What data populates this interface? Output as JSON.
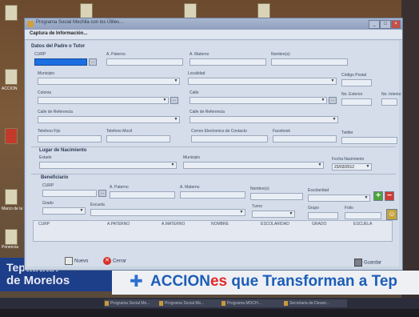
{
  "window": {
    "title": "Programa Social Mochila con los Útiles...",
    "menu": "Captura de Información..."
  },
  "padre": {
    "section": "Datos del Padre o Tutor",
    "curp_label": "CURP",
    "paterno_label": "A. Paterno",
    "materno_label": "A. Materno",
    "nombre_label": "Nombre(s)",
    "municipio_label": "Municipio",
    "localidad_label": "Localidad",
    "cp_label": "Código Postal",
    "colonia_label": "Colonia",
    "calle_label": "Calle",
    "no_ext_label": "No. Exterior",
    "no_int_label": "No. Interior",
    "calle_ref1_label": "Calle de Referencia",
    "calle_ref2_label": "Calle de Referencia",
    "tel_fijo_label": "Telefono Fijo",
    "tel_movil_label": "Telefono Movil",
    "correo_label": "Correo Electronico de Contacto",
    "facebook_label": "Facebook",
    "twitter_label": "Twitter"
  },
  "nacimiento": {
    "section": "Lugar de Nacimiento",
    "estado_label": "Estado",
    "municipio_label": "Municipio",
    "fecha_label": "Fecha Nacimiento",
    "fecha_value": "23/03/2012"
  },
  "beneficiario": {
    "section": "Beneficiario",
    "curp_label": "CURP",
    "paterno_label": "A. Paterno",
    "materno_label": "A. Materno",
    "nombre_label": "Nombre(s)",
    "escolaridad_label": "Escolaridad",
    "grado_label": "Grado",
    "escuela_label": "Escuela",
    "turno_label": "Turno",
    "grupo_label": "Grupo",
    "folio_label": "Folio"
  },
  "grid_columns": [
    "CURP",
    "A.PATERNO",
    "A.MATERNO",
    "NOMBRE",
    "ESCOLARIDAD",
    "GRADO",
    "ESCUELA"
  ],
  "buttons": {
    "nuevo": "Nuevo",
    "cerrar": "Cerrar",
    "guardar": "Guardar",
    "browse": "...",
    "add": "+",
    "remove": "−"
  },
  "banner": {
    "left_line1": "Tepatitlan",
    "left_line2": "de Morelos",
    "slogan_a": "ACCION",
    "slogan_es": "es",
    "slogan_b": " que Transforman a Tep"
  },
  "taskbar": [
    "Programa Social Mo...",
    "Programa Social Mo...",
    "Programa MOCH...",
    "Secretaria de Desarr..."
  ],
  "desktop_icons": [
    "ACCION",
    "Marco de la T...",
    "Ponencia"
  ],
  "colors": {
    "curp_field": "#1c6fe0",
    "add_button": "#4aa63b",
    "remove_button": "#d23a35",
    "banner_blue": "#1d5db8",
    "banner_red": "#e0292a"
  }
}
